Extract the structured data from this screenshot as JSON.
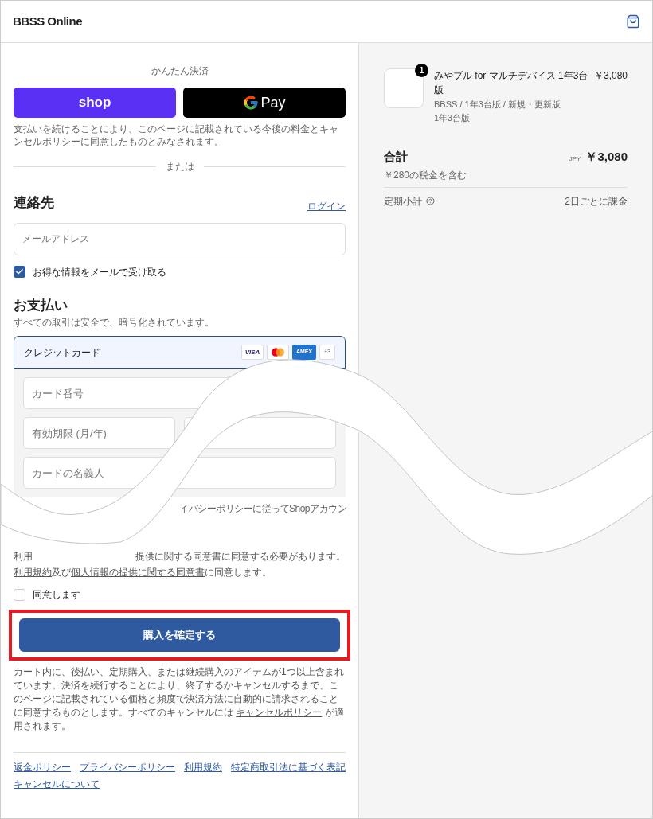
{
  "header": {
    "store_name": "BBSS Online"
  },
  "express": {
    "title": "かんたん決済",
    "shop_label": "shop",
    "gpay_label": "Pay",
    "disclaimer": "支払いを続けることにより、このページに記載されている今後の料金とキャンセルポリシーに同意したものとみなされます。",
    "divider": "または"
  },
  "contact": {
    "title": "連絡先",
    "login_link": "ログイン",
    "email": {
      "placeholder": "メールアドレス"
    },
    "newsletter": {
      "label": "お得な情報をメールで受け取る",
      "checked": true
    }
  },
  "payment": {
    "title": "お支払い",
    "subtitle": "すべての取引は安全で、暗号化されています。",
    "method": {
      "label": "クレジットカード",
      "selected": true,
      "brands": [
        "VISA",
        "AMEX"
      ],
      "more": "+3"
    },
    "fields": [
      {
        "placeholder": "カード番号",
        "kind": "full"
      },
      {
        "placeholder": "有効期限 (月/年)",
        "kind": "half"
      },
      {
        "kind": "half"
      },
      {
        "placeholder": "カードの名義人",
        "kind": "full"
      }
    ]
  },
  "shop_notice_fragment": "イバシーポリシーに従ってShopアカウン",
  "terms": {
    "fragment_left": "利用",
    "fragment_right": "提供に関する同意書に同意する必要があります。",
    "agreement": [
      {
        "text": "利用規約",
        "kind": "link"
      },
      {
        "text": "及び",
        "kind": "text"
      },
      {
        "text": "個人情報の提供に関する同意書",
        "kind": "link"
      },
      {
        "text": "に同意します。",
        "kind": "text"
      }
    ],
    "agree_checkbox": {
      "label": "同意します",
      "checked": false
    }
  },
  "submit": {
    "label": "購入を確定する",
    "highlighted": true
  },
  "notice": [
    {
      "text": "カート内に、後払い、定期購入、または継続購入のアイテムが1つ以上含まれています。決済を続行することにより、終了するかキャンセルするまで、このページに記載されている価格と頻度で決済方法に自動的に請求されることに同意するものとします。すべてのキャンセルには ",
      "kind": "text"
    },
    {
      "text": "キャンセルポリシー",
      "kind": "link"
    },
    {
      "text": " が適用されます。",
      "kind": "text"
    }
  ],
  "footer_links": [
    "返金ポリシー",
    "プライバシーポリシー",
    "利用規約",
    "特定商取引法に基づく表記",
    "キャンセルについて"
  ],
  "summary": {
    "item": {
      "quantity": "1",
      "title": "みやブル for マルチデバイス 1年3台版",
      "variant": "BBSS / 1年3台版 / 新規・更新版",
      "plan": "1年3台版",
      "price": "￥3,080"
    },
    "total_label": "合計",
    "currency": "JPY",
    "total": "￥3,080",
    "tax": "￥280の税金を含む",
    "recurring_label": "定期小計",
    "recurring_value": "2日ごとに課金"
  }
}
